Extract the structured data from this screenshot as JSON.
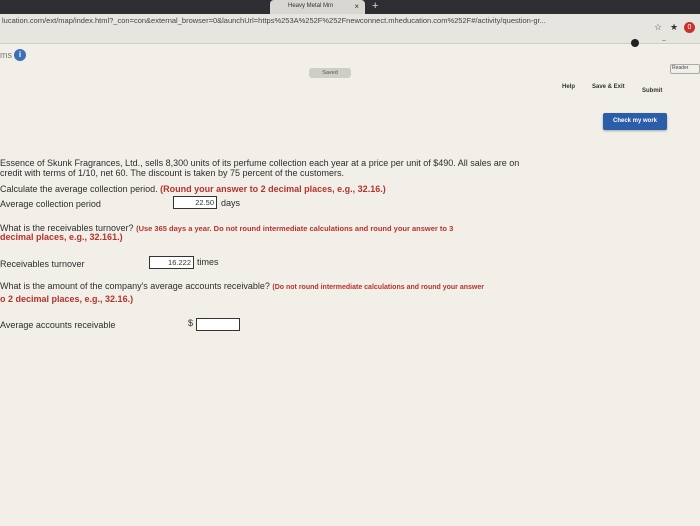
{
  "browser": {
    "tab_title": "Heavy Metal Mrn",
    "tab_close": "×",
    "new_tab": "+",
    "url": "lucation.com/ext/map/index.html?_con=con&external_browser=0&launchUrl=https%253A%252F%252Fnewconnect.mheducation.com%252F#/activity/question-gr...",
    "extension_badge": "0"
  },
  "header": {
    "ms_label": "ms",
    "info_icon": "i",
    "saved": "Saved",
    "reader": "Reader"
  },
  "toolbar": {
    "help": "Help",
    "save_exit": "Save & Exit",
    "submit": "Submit",
    "check_my_work": "Check my work"
  },
  "question": {
    "intro_1": "Essence of Skunk Fragrances, Ltd., sells 8,300 units of its perfume collection each year at a price per unit of $490. All sales are on",
    "intro_2": "credit with terms of 1/10, net 60. The discount is taken by 75 percent of the customers.",
    "q1_text": "Calculate the average collection period.",
    "q1_instr": "(Round your answer to 2 decimal places, e.g., 32.16.)",
    "q1_label": "Average collection period",
    "q1_value": "22.50",
    "q1_unit": "days",
    "q2_text": "What is the receivables turnover?",
    "q2_instr_1": "(Use 365 days a year. Do not round intermediate calculations and round your answer to 3",
    "q2_instr_2": "decimal places, e.g., 32.161.)",
    "q2_label": "Receivables turnover",
    "q2_value": "16.222",
    "q2_unit": "times",
    "q3_text": "What is the amount of the company's average accounts receivable?",
    "q3_instr_1": "(Do not round intermediate calculations and round your answer",
    "q3_instr_2": "o 2 decimal places, e.g., 32.16.)",
    "q3_label": "Average accounts receivable",
    "q3_currency": "$",
    "q3_value": ""
  }
}
